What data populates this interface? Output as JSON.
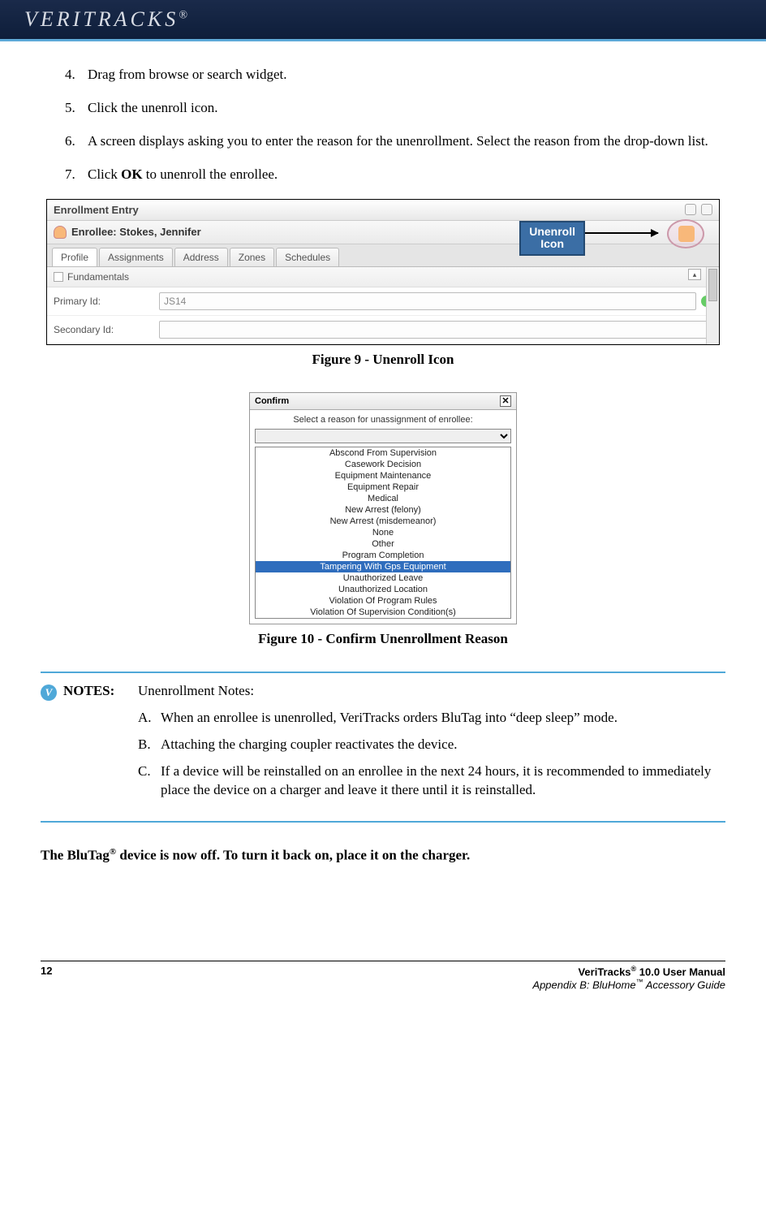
{
  "header": {
    "brand": "VERITRACKS",
    "reg": "®"
  },
  "steps": [
    {
      "n": "4.",
      "text": "Drag from browse or search widget."
    },
    {
      "n": "5.",
      "text": "Click the unenroll icon."
    },
    {
      "n": "6.",
      "text": "A screen displays asking you to enter the reason for the unenrollment. Select the reason from the drop-down list."
    },
    {
      "n": "7.",
      "prefix": "Click ",
      "bold": "OK",
      "suffix": " to unenroll the enrollee."
    }
  ],
  "figure9": {
    "panel_title": "Enrollment Entry",
    "enrollee_label": "Enrollee: Stokes, Jennifer",
    "tabs": [
      "Profile",
      "Assignments",
      "Address",
      "Zones",
      "Schedules"
    ],
    "section": "Fundamentals",
    "field1_label": "Primary Id:",
    "field1_value": "JS14",
    "field2_label": "Secondary Id:",
    "field2_value": "",
    "callout_l1": "Unenroll",
    "callout_l2": "Icon",
    "caption": "Figure 9 - Unenroll Icon"
  },
  "figure10": {
    "title": "Confirm",
    "prompt": "Select a reason for unassignment of enrollee:",
    "options": [
      "Abscond From Supervision",
      "Casework Decision",
      "Equipment Maintenance",
      "Equipment Repair",
      "Medical",
      "New Arrest (felony)",
      "New Arrest (misdemeanor)",
      "None",
      "Other",
      "Program Completion",
      "Tampering With Gps Equipment",
      "Unauthorized Leave",
      "Unauthorized Location",
      "Violation Of Program Rules",
      "Violation Of Supervision Condition(s)"
    ],
    "selected_index": 10,
    "caption": "Figure 10 - Confirm Unenrollment Reason"
  },
  "notes": {
    "label": "NOTES:",
    "title": "Unenrollment Notes:",
    "items": [
      {
        "mark": "A.",
        "text": "When an enrollee is unenrolled, VeriTracks orders BluTag into “deep sleep” mode."
      },
      {
        "mark": "B.",
        "text": "Attaching the charging coupler reactivates the device."
      },
      {
        "mark": "C.",
        "text": "If a device will be reinstalled on an enrollee in the next 24 hours, it is recommended to immediately place the device on a charger and leave it there until it is reinstalled."
      }
    ]
  },
  "final": {
    "pre": "The BluTag",
    "sup": "®",
    "post": " device is now off. To turn it back on, place it on the charger."
  },
  "footer": {
    "page": "12",
    "l1a": "VeriTracks",
    "l1sup": "®",
    "l1b": " 10.0 User Manual",
    "l2a": "Appendix B: BluHome",
    "l2sup": "™",
    "l2b": " Accessory Guide"
  }
}
